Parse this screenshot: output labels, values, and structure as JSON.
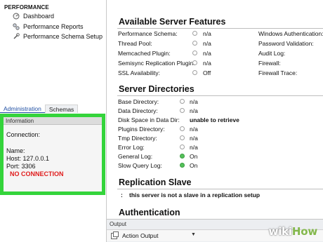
{
  "navigator": {
    "section_title": "PERFORMANCE",
    "items": [
      {
        "label": "Dashboard",
        "icon": "dashboard-icon"
      },
      {
        "label": "Performance Reports",
        "icon": "reports-icon"
      },
      {
        "label": "Performance Schema Setup",
        "icon": "wrench-icon"
      }
    ],
    "tabs": [
      {
        "label": "Administration",
        "active": true
      },
      {
        "label": "Schemas",
        "active": false
      }
    ]
  },
  "information": {
    "header": "Information",
    "connection_label": "Connection:",
    "name_label": "Name:",
    "host": "Host: 127.0.0.1",
    "port": "Port: 3306",
    "status": "NO CONNECTION"
  },
  "server_features": {
    "title": "Available Server Features",
    "left": [
      {
        "label": "Performance Schema:",
        "value": "n/a",
        "on": false
      },
      {
        "label": "Thread Pool:",
        "value": "n/a",
        "on": false
      },
      {
        "label": "Memcached Plugin:",
        "value": "n/a",
        "on": false
      },
      {
        "label": "Semisync Replication Plugin:",
        "value": "n/a",
        "on": false
      },
      {
        "label": "SSL Availability:",
        "value": "Off",
        "on": false
      }
    ],
    "right": [
      "Windows Authentication:",
      "Password Validation:",
      "Audit Log:",
      "Firewall:",
      "Firewall Trace:"
    ]
  },
  "server_directories": {
    "title": "Server Directories",
    "rows": [
      {
        "label": "Base Directory:",
        "value": "n/a",
        "on": false,
        "radio": true
      },
      {
        "label": "Data Directory:",
        "value": "n/a",
        "on": false,
        "radio": true
      },
      {
        "label": "Disk Space in Data Dir:",
        "value": "unable to retrieve",
        "on": false,
        "radio": false
      },
      {
        "label": "Plugins Directory:",
        "value": "n/a",
        "on": false,
        "radio": true
      },
      {
        "label": "Tmp Directory:",
        "value": "n/a",
        "on": false,
        "radio": true
      },
      {
        "label": "Error Log:",
        "value": "n/a",
        "on": false,
        "radio": true
      },
      {
        "label": "General Log:",
        "value": "On",
        "on": true,
        "radio": true
      },
      {
        "label": "Slow Query Log:",
        "value": "On",
        "on": true,
        "radio": true
      }
    ]
  },
  "replication": {
    "title": "Replication Slave",
    "separator": ":",
    "message": "this server is not a slave in a replication setup"
  },
  "authentication": {
    "title": "Authentication"
  },
  "output": {
    "label": "Output",
    "selector": "Action Output"
  },
  "watermark": {
    "part1": "wiki",
    "part2": "How"
  }
}
